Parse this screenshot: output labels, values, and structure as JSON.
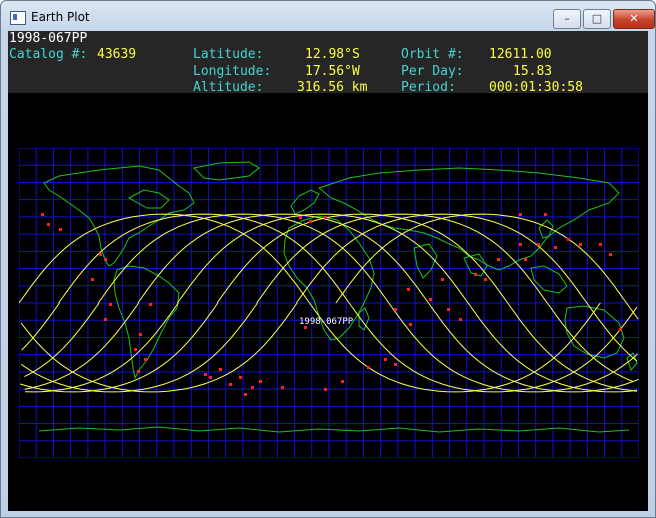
{
  "window": {
    "title": "Earth Plot",
    "buttons": {
      "minimize": "–",
      "maximize": "□",
      "close": "✕"
    }
  },
  "header": {
    "satellite_name": "1998-067PP",
    "catalog_label": "Catalog #:",
    "catalog_value": "43639",
    "latitude_label": "Latitude:",
    "latitude_value": "12.98°S",
    "longitude_label": "Longitude:",
    "longitude_value": "17.56°W",
    "altitude_label": "Altitude:",
    "altitude_value": "316.56 km",
    "orbit_label": "Orbit #:",
    "orbit_value": "12611.00",
    "perday_label": "Per Day:",
    "perday_value": "15.83",
    "period_label": "Period:",
    "period_value": "000:01:30:58"
  },
  "map": {
    "satellite_marker_label": "1998-067PP",
    "colors": {
      "grid": "#1010d0",
      "coast": "#20c020",
      "track": "#ffff50",
      "stations": "#ff2020",
      "label": "#ffffff"
    }
  }
}
